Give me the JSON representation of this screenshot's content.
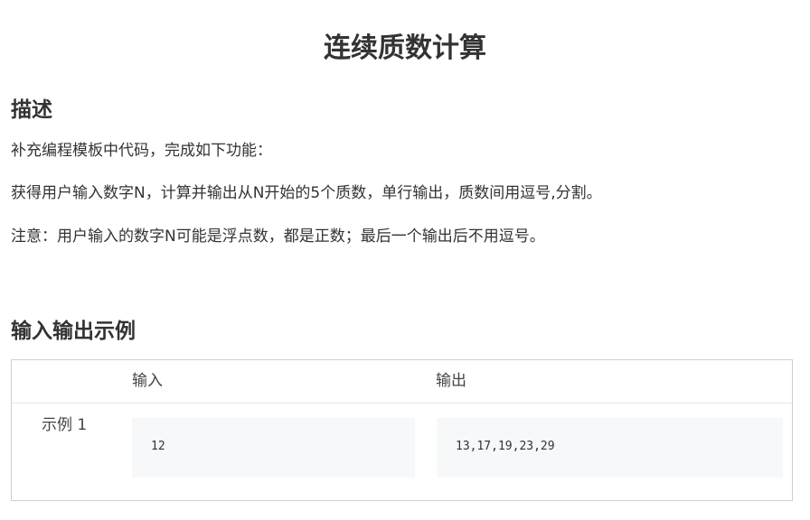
{
  "page": {
    "title": "连续质数计算"
  },
  "description": {
    "heading": "描述",
    "paragraphs": [
      "补充编程模板中代码，完成如下功能：",
      "获得用户输入数字N，计算并输出从N开始的5个质数，单行输出，质数间用逗号,分割。",
      "注意：用户输入的数字N可能是浮点数，都是正数；最后一个输出后不用逗号。"
    ]
  },
  "examples": {
    "heading": "输入输出示例",
    "columns": {
      "input": "输入",
      "output": "输出"
    },
    "rows": [
      {
        "label": "示例 1",
        "input": "12",
        "output": "13,17,19,23,29"
      }
    ]
  }
}
